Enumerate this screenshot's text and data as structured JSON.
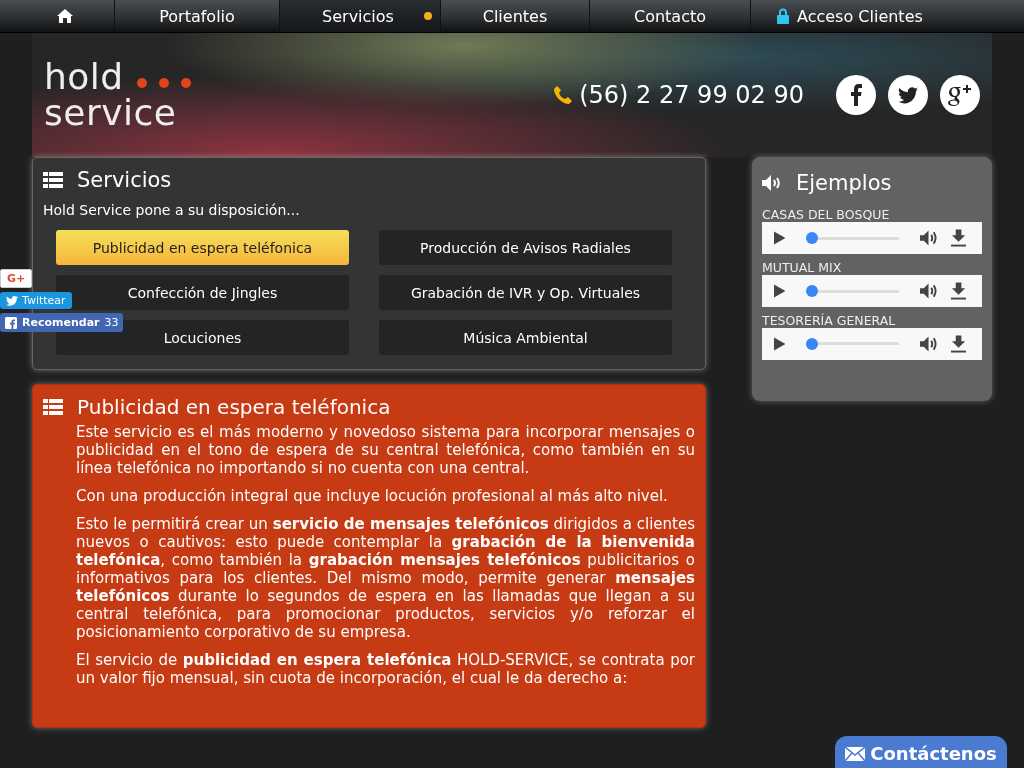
{
  "nav": [
    {
      "kind": "home",
      "selected": false
    },
    {
      "kind": "text",
      "label": "Portafolio",
      "selected": false
    },
    {
      "kind": "text",
      "label": "Servicios",
      "selected": true
    },
    {
      "kind": "text",
      "label": "Clientes",
      "selected": false
    },
    {
      "kind": "text",
      "label": "Contacto",
      "selected": false
    },
    {
      "kind": "lock",
      "label": "Acceso Clientes",
      "selected": false
    }
  ],
  "header": {
    "logo_top": "hold",
    "logo_bottom": "service",
    "phone": "(56) 2 27 99 02 90"
  },
  "services": {
    "title": "Servicios",
    "intro": "Hold Service pone a su disposición...",
    "items": [
      {
        "label": "Publicidad en espera teléfonica",
        "selected": true
      },
      {
        "label": "Producción de Avisos Radiales",
        "selected": false
      },
      {
        "label": "Confección de Jingles",
        "selected": false
      },
      {
        "label": "Grabación de IVR y Op. Virtuales",
        "selected": false
      },
      {
        "label": "Locuciones",
        "selected": false
      },
      {
        "label": "Música Ambiental",
        "selected": false
      }
    ]
  },
  "examples": {
    "title": "Ejemplos",
    "tracks": [
      {
        "name": "CASAS DEL BOSQUE",
        "level": 0
      },
      {
        "name": "MUTUAL MIX",
        "level": 0
      },
      {
        "name": "TESORERÍA GENERAL",
        "level": 0
      }
    ]
  },
  "detail": {
    "title": "Publicidad en espera teléfonica",
    "paragraphs": [
      "Este servicio es el más moderno y novedoso sistema para incorporar mensajes o publicidad en el tono de espera de su central telefónica, como también en su línea telefónica no importando si no cuenta con una central.",
      "Con una producción integral que incluye locución profesional al más alto nivel.",
      "Esto le permitirá crear un **servicio de mensajes telefónicos** dirigidos a clientes nuevos o cautivos: esto puede contemplar la **grabación de la bienvenida telefónica**, como también la **grabación mensajes telefónicos** publicitarios o informativos para los clientes. Del mismo modo, permite generar **mensajes telefónicos** durante lo segundos de espera en las llamadas que llegan a su central telefónica, para promocionar productos, servicios y/o reforzar el posicionamiento corporativo de su empresa.",
      "El servicio de **publicidad en espera telefónica** HOLD-SERVICE, se contrata por un valor fijo mensual, sin cuota de incorporación, el cual le da derecho a:"
    ]
  },
  "share": {
    "gplus": "G+",
    "tweet": "Twittear",
    "recommend": "Recomendar",
    "count": "33"
  },
  "contact_button": "Contáctenos"
}
